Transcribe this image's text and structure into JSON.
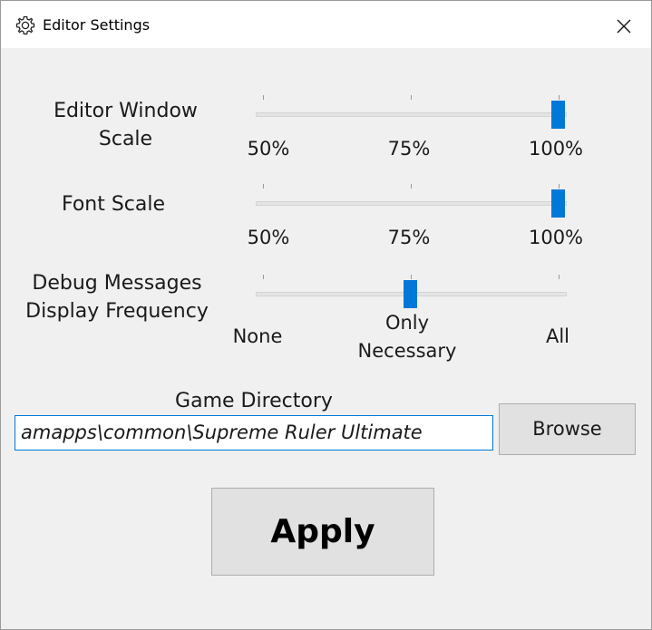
{
  "window": {
    "title": "Editor Settings",
    "icon": "gear-icon",
    "close_icon": "close-icon"
  },
  "settings": {
    "editor_window_scale": {
      "label_line1": "Editor Window",
      "label_line2": "Scale",
      "ticks": [
        "50%",
        "75%",
        "100%"
      ],
      "value": "100%"
    },
    "font_scale": {
      "label": "Font Scale",
      "ticks": [
        "50%",
        "75%",
        "100%"
      ],
      "value": "100%"
    },
    "debug_messages": {
      "label_line1": "Debug Messages",
      "label_line2": "Display Frequency",
      "tick_none": "None",
      "tick_only_line1": "Only",
      "tick_only_line2": "Necessary",
      "tick_all": "All",
      "value": "Only Necessary"
    }
  },
  "game_directory": {
    "label": "Game Directory",
    "value_plain": "amapps\\common\\",
    "value_italic": "Supreme Ruler Ultimate"
  },
  "buttons": {
    "browse": "Browse",
    "apply": "Apply"
  },
  "colors": {
    "accent": "#0078d7",
    "window_bg": "#f0f0f0",
    "button_bg": "#e1e1e1"
  }
}
